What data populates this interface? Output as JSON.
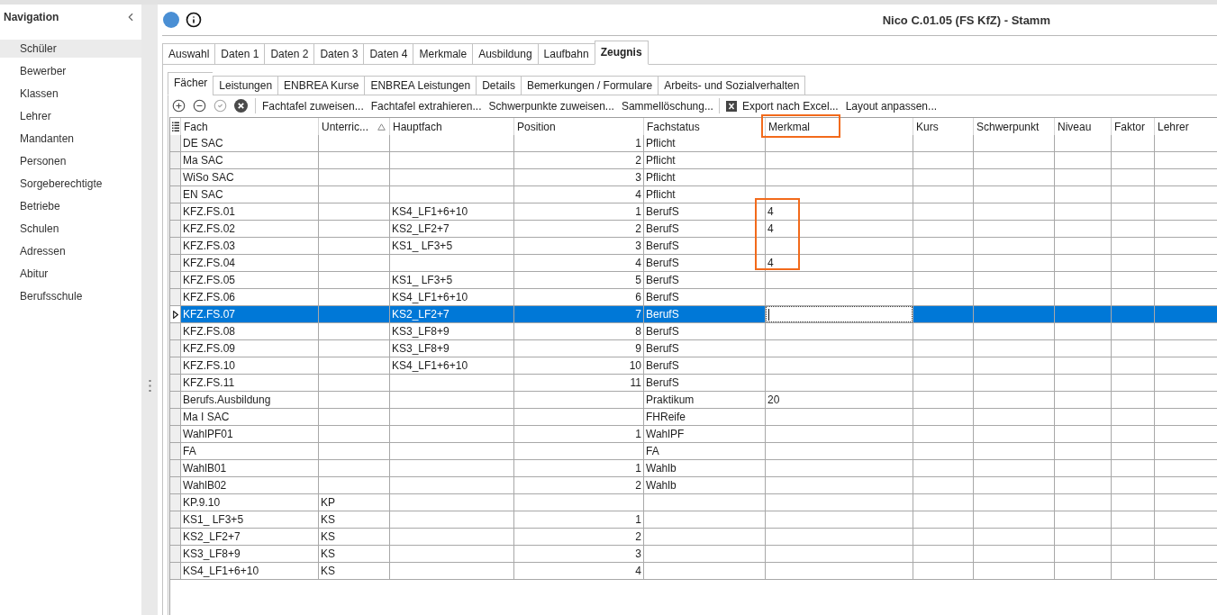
{
  "navigation": {
    "title": "Navigation",
    "items": [
      {
        "label": "Schüler",
        "selected": true
      },
      {
        "label": "Bewerber",
        "selected": false
      },
      {
        "label": "Klassen",
        "selected": false
      },
      {
        "label": "Lehrer",
        "selected": false
      },
      {
        "label": "Mandanten",
        "selected": false
      },
      {
        "label": "Personen",
        "selected": false
      },
      {
        "label": "Sorgeberechtigte",
        "selected": false
      },
      {
        "label": "Betriebe",
        "selected": false
      },
      {
        "label": "Schulen",
        "selected": false
      },
      {
        "label": "Adressen",
        "selected": false
      },
      {
        "label": "Abitur",
        "selected": false
      },
      {
        "label": "Berufsschule",
        "selected": false
      }
    ]
  },
  "header": {
    "title": "Nico C.01.05 (FS KfZ) - Stamm"
  },
  "tabs": [
    {
      "label": "Auswahl",
      "selected": false
    },
    {
      "label": "Daten 1",
      "selected": false
    },
    {
      "label": "Daten 2",
      "selected": false
    },
    {
      "label": "Daten 3",
      "selected": false
    },
    {
      "label": "Daten 4",
      "selected": false
    },
    {
      "label": "Merkmale",
      "selected": false
    },
    {
      "label": "Ausbildung",
      "selected": false
    },
    {
      "label": "Laufbahn",
      "selected": false
    },
    {
      "label": "Zeugnis",
      "selected": true
    }
  ],
  "sub_tabs": [
    {
      "label": "Fächer",
      "selected": true
    },
    {
      "label": "Leistungen",
      "selected": false
    },
    {
      "label": "ENBREA Kurse",
      "selected": false
    },
    {
      "label": "ENBREA Leistungen",
      "selected": false
    },
    {
      "label": "Details",
      "selected": false
    },
    {
      "label": "Bemerkungen / Formulare",
      "selected": false
    },
    {
      "label": "Arbeits- und Sozialverhalten",
      "selected": false
    }
  ],
  "toolbar": {
    "icon_buttons": [
      {
        "disabled": false
      },
      {
        "disabled": false
      },
      {
        "disabled": true
      },
      {
        "disabled": false
      }
    ],
    "command_groups": [
      {
        "items": [
          {
            "kind": "command",
            "label": "Fachtafel zuweisen..."
          },
          {
            "kind": "command",
            "label": "Fachtafel extrahieren..."
          },
          {
            "kind": "command",
            "label": "Schwerpunkte zuweisen..."
          },
          {
            "kind": "command",
            "label": "Sammellöschung..."
          }
        ]
      },
      {
        "items": [
          {
            "kind": "export",
            "label": "Export nach Excel..."
          },
          {
            "kind": "command",
            "label": "Layout anpassen..."
          }
        ]
      }
    ]
  },
  "table": {
    "columns": [
      {
        "label": "Fach",
        "sorted": false,
        "marked": false
      },
      {
        "label": "Unterric...",
        "sorted": true,
        "marked": false
      },
      {
        "label": "Hauptfach",
        "sorted": false,
        "marked": false
      },
      {
        "label": "Position",
        "sorted": false,
        "marked": false
      },
      {
        "label": "Fachstatus",
        "sorted": false,
        "marked": false
      },
      {
        "label": "Merkmal",
        "sorted": false,
        "marked": true
      },
      {
        "label": "Kurs",
        "sorted": false,
        "marked": false
      },
      {
        "label": "Schwerpunkt",
        "sorted": false,
        "marked": false
      },
      {
        "label": "Niveau",
        "sorted": false,
        "marked": false
      },
      {
        "label": "Faktor",
        "sorted": false,
        "marked": false
      },
      {
        "label": "Lehrer",
        "sorted": false,
        "marked": false
      }
    ],
    "rows": [
      {
        "kind": "row",
        "cells": [
          "DE SAC",
          null,
          null,
          "1",
          "Pflicht",
          null
        ],
        "selected": false,
        "editing": false
      },
      {
        "kind": "row",
        "cells": [
          "Ma SAC",
          null,
          null,
          "2",
          "Pflicht",
          null
        ],
        "selected": false,
        "editing": false
      },
      {
        "kind": "row",
        "cells": [
          "WiSo SAC",
          null,
          null,
          "3",
          "Pflicht",
          null
        ],
        "selected": false,
        "editing": false
      },
      {
        "kind": "row",
        "cells": [
          "EN SAC",
          null,
          null,
          "4",
          "Pflicht",
          null
        ],
        "selected": false,
        "editing": false
      },
      {
        "kind": "framed",
        "rows": [
          {
            "cells": [
              "KFZ.FS.01",
              null,
              "KS4_LF1+6+10",
              "1",
              "BerufS",
              "4"
            ],
            "selected": false,
            "editing": false
          },
          {
            "cells": [
              "KFZ.FS.02",
              null,
              "KS2_LF2+7",
              "2",
              "BerufS",
              "4"
            ],
            "selected": false,
            "editing": false
          },
          {
            "cells": [
              "KFZ.FS.03",
              null,
              "KS1_ LF3+5",
              "3",
              "BerufS",
              null
            ],
            "selected": false,
            "editing": false
          },
          {
            "cells": [
              "KFZ.FS.04",
              null,
              null,
              "4",
              "BerufS",
              "4"
            ],
            "selected": false,
            "editing": false
          }
        ]
      },
      {
        "kind": "row",
        "cells": [
          "KFZ.FS.05",
          null,
          "KS1_ LF3+5",
          "5",
          "BerufS",
          null
        ],
        "selected": false,
        "editing": false
      },
      {
        "kind": "row",
        "cells": [
          "KFZ.FS.06",
          null,
          "KS4_LF1+6+10",
          "6",
          "BerufS",
          null
        ],
        "selected": false,
        "editing": false
      },
      {
        "kind": "row",
        "cells": [
          "KFZ.FS.07",
          null,
          "KS2_LF2+7",
          "7",
          "BerufS",
          null
        ],
        "selected": true,
        "editing": true
      },
      {
        "kind": "row",
        "cells": [
          "KFZ.FS.08",
          null,
          "KS3_LF8+9",
          "8",
          "BerufS",
          null
        ],
        "selected": false,
        "editing": false
      },
      {
        "kind": "row",
        "cells": [
          "KFZ.FS.09",
          null,
          "KS3_LF8+9",
          "9",
          "BerufS",
          null
        ],
        "selected": false,
        "editing": false
      },
      {
        "kind": "row",
        "cells": [
          "KFZ.FS.10",
          null,
          "KS4_LF1+6+10",
          "10",
          "BerufS",
          null
        ],
        "selected": false,
        "editing": false
      },
      {
        "kind": "row",
        "cells": [
          "KFZ.FS.11",
          null,
          null,
          "11",
          "BerufS",
          null
        ],
        "selected": false,
        "editing": false
      },
      {
        "kind": "row",
        "cells": [
          "Berufs.Ausbildung",
          null,
          null,
          null,
          "Praktikum",
          "20"
        ],
        "selected": false,
        "editing": false
      },
      {
        "kind": "row",
        "cells": [
          "Ma I SAC",
          null,
          null,
          null,
          "FHReife",
          null
        ],
        "selected": false,
        "editing": false
      },
      {
        "kind": "row",
        "cells": [
          "WahlPF01",
          null,
          null,
          "1",
          "WahlPF",
          null
        ],
        "selected": false,
        "editing": false
      },
      {
        "kind": "row",
        "cells": [
          "FA",
          null,
          null,
          null,
          "FA",
          null
        ],
        "selected": false,
        "editing": false
      },
      {
        "kind": "row",
        "cells": [
          "WahlB01",
          null,
          null,
          "1",
          "Wahlb",
          null
        ],
        "selected": false,
        "editing": false
      },
      {
        "kind": "row",
        "cells": [
          "WahlB02",
          null,
          null,
          "2",
          "Wahlb",
          null
        ],
        "selected": false,
        "editing": false
      },
      {
        "kind": "row",
        "cells": [
          "KP.9.10",
          "KP",
          null,
          null,
          null,
          null
        ],
        "selected": false,
        "editing": false
      },
      {
        "kind": "row",
        "cells": [
          "KS1_ LF3+5",
          "KS",
          null,
          "1",
          null,
          null
        ],
        "selected": false,
        "editing": false
      },
      {
        "kind": "row",
        "cells": [
          "KS2_LF2+7",
          "KS",
          null,
          "2",
          null,
          null
        ],
        "selected": false,
        "editing": false
      },
      {
        "kind": "row",
        "cells": [
          "KS3_LF8+9",
          "KS",
          null,
          "3",
          null,
          null
        ],
        "selected": false,
        "editing": false
      },
      {
        "kind": "row",
        "cells": [
          "KS4_LF1+6+10",
          "KS",
          null,
          "4",
          null,
          null
        ],
        "selected": false,
        "editing": false
      }
    ]
  }
}
